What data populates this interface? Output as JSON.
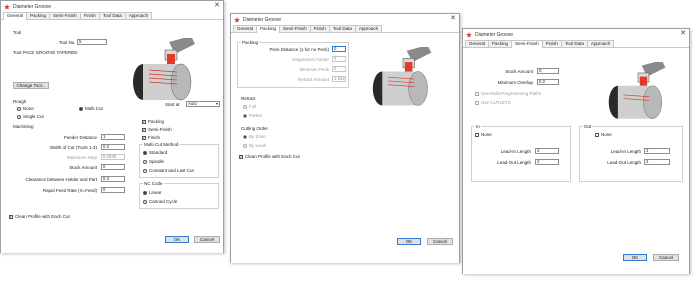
{
  "win1": {
    "title": "Diameter Groove",
    "close": "✕",
    "tabs": [
      "General",
      "Packing",
      "Semi-Finish",
      "Finish",
      "Tool Data",
      "Approach"
    ],
    "tool_group": "Tool",
    "tool_no_label": "Tool No.",
    "tool_no": "5",
    "tool_desc": "Tool PACE GROOVE TAPERED",
    "change_tool": "Change Tool...",
    "rough_group": "Rough",
    "rough_none": "None",
    "rough_multi": "Multi Cut",
    "rough_single": "Single Cut",
    "start_at_label": "Start at",
    "start_at": "Auto",
    "machining_group": "Machining",
    "feeder_distance_label": "Feeder Distance",
    "feeder_distance": "1",
    "width_of_cut_label": "Width of Cut (Tools 1-3)",
    "width_of_cut": "0.2",
    "maximum_step_label": "Maximum Step",
    "maximum_step": "0.2535",
    "stock_amount_label": "Stock Amount",
    "stock_amount": "0",
    "clearance_label": "Clearance between Holder and Part",
    "clearance": "0.3",
    "rapid_feed_label": "Rapid Feed Rate (X=Feed)",
    "rapid_feed": "0",
    "chk_packing": "Packing",
    "chk_semifinish": "Semi-Finish",
    "chk_finish": "Finish",
    "multicut_group": "Multi-Cut Method",
    "mc_standard": "Standard",
    "mc_spindle": "Spindle",
    "mc_constant": "Constant and Last Cut",
    "nccode_group": "NC Code",
    "nc_linear": "Linear",
    "nc_canned": "Canned Cycle",
    "clean_profile": "Clean Profile with Each Cut",
    "ok": "OK",
    "cancel": "Cancel"
  },
  "win2": {
    "title": "Diameter Groove",
    "close": "✕",
    "tabs": [
      "General",
      "Packing",
      "Semi-Finish",
      "Finish",
      "Tool Data",
      "Approach"
    ],
    "packing_group": "Packing",
    "peck_label": "Peck Distance (1 for no Peck)",
    "peck": "0",
    "degression_label": "Degression Factor",
    "degression": "0",
    "minimum_peck_label": "Minimum Peck",
    "minimum_peck": "0",
    "retract_amount_label": "Retract Amount",
    "retract_amount": "1.942",
    "retract_group": "Retract",
    "rt_full": "Full",
    "rt_partial": "Partial",
    "cutting_order_group": "Cutting Order",
    "co_by_zone": "By Zone",
    "co_by_level": "By Level",
    "clean_profile": "Clean Profile with Each Cut",
    "ok": "OK",
    "cancel": "Cancel"
  },
  "win3": {
    "title": "Diameter Groove",
    "close": "✕",
    "tabs": [
      "General",
      "Packing",
      "Semi-Finish",
      "Finish",
      "Tool Data",
      "Approach"
    ],
    "stock_amount_label": "Stock Amount",
    "stock_amount": "0",
    "minimum_overlap_label": "Minimum Overlap",
    "minimum_overlap": "0.2",
    "chk_multi_prog": "Use Multi-Programming Paths",
    "chk_use_cutlets": "Use CUTLETS",
    "in_group": "In",
    "in_none": "None",
    "in_lead_in_label": "Lead-In Length",
    "in_lead_in": "2",
    "in_lead_out_label": "Lead-Out Length",
    "in_lead_out": "2",
    "out_group": "Out",
    "out_none": "None",
    "out_lead_in_label": "Lead-In Length",
    "out_lead_in": "2",
    "out_lead_out_label": "Lead-Out Length",
    "out_lead_out": "2",
    "ok": "OK",
    "cancel": "Cancel"
  },
  "colors": {
    "accent": "#2d7cd6",
    "icon_red": "#d23a2a",
    "border": "#9aa0a6"
  }
}
